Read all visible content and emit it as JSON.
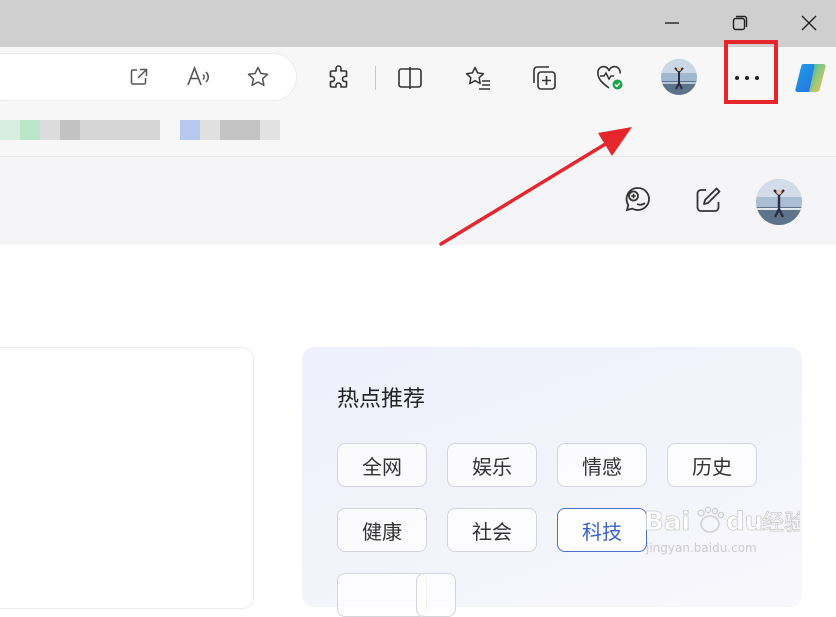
{
  "window": {
    "controls": [
      "minimize-icon",
      "restore-icon",
      "close-icon"
    ]
  },
  "address_bar": {
    "icons": [
      "open-in-app-icon",
      "read-aloud-icon",
      "favorite-star-icon"
    ]
  },
  "toolbar": {
    "icons": [
      "extensions-icon",
      "split-screen-icon",
      "favorites-icon",
      "collections-icon",
      "browser-essentials-icon",
      "profile-avatar",
      "more-options-icon",
      "copilot-icon"
    ]
  },
  "page_header": {
    "icons": [
      "chat-icon",
      "compose-icon",
      "user-avatar"
    ]
  },
  "hot_panel": {
    "title": "热点推荐",
    "tags": [
      {
        "label": "全网",
        "active": false
      },
      {
        "label": "娱乐",
        "active": false
      },
      {
        "label": "情感",
        "active": false
      },
      {
        "label": "历史",
        "active": false
      },
      {
        "label": "健康",
        "active": false
      },
      {
        "label": "社会",
        "active": false
      },
      {
        "label": "科技",
        "active": true
      }
    ]
  },
  "watermark": {
    "brand": "Baidu",
    "word": "经验",
    "url": "jingyan.baidu.com"
  },
  "colors": {
    "highlight": "#e5262d",
    "active_tag": "#3b63c9",
    "titlebar": "#cfcfcf"
  }
}
